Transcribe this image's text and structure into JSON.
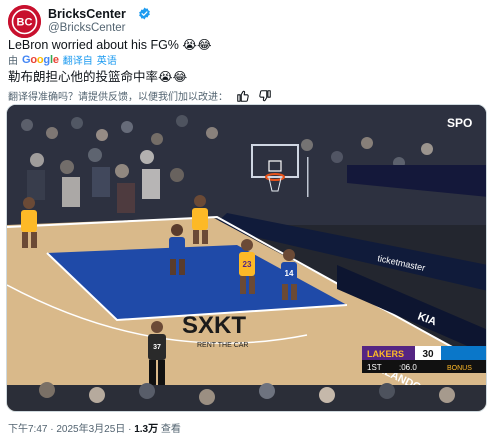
{
  "account": {
    "display_name": "BricksCenter",
    "handle": "@BricksCenter",
    "avatar_text": "BC"
  },
  "tweet": {
    "text": "LeBron worried about his FG% 😭😂",
    "translated_by_prefix": "由",
    "translated_by_brand": "Google",
    "translated_by_suffix": "翻译自",
    "source_language": "英语",
    "translated_text": "勒布朗担心他的投篮命中率😭😂",
    "feedback_prompt": "翻译得准确吗？请提供反馈，以便我们加以改进："
  },
  "media": {
    "court_logo": "SXKT",
    "court_sub": "RENT THE CAR",
    "scoreboard": {
      "team_left": "LAKERS",
      "score_left": "30",
      "score_right": "",
      "quarter": "1ST",
      "clock": ":06.0",
      "bonus_label": "BONUS"
    },
    "jersey_left": "23",
    "jersey_right": "14",
    "jersey_ref": "37",
    "sign_ticketmaster": "ticketmaster",
    "sign_kia": "KIA",
    "sign_orlando": "ORLANDO",
    "sign_spo": "SPO"
  },
  "footer": {
    "time": "下午7:47",
    "date": "2025年3月25日",
    "views": "1.3万",
    "views_label": "查看"
  },
  "colors": {
    "brand_red": "#c8102e",
    "link_blue": "#1d9bf0",
    "court_blue": "#1f4aa8",
    "court_wood": "#d9b98a",
    "lakers_purple": "#552583",
    "lakers_gold": "#fdb927"
  }
}
